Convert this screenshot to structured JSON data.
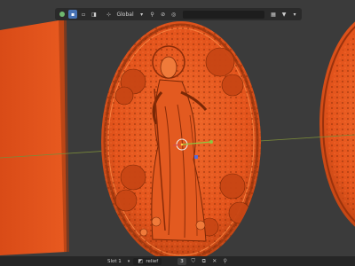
{
  "header": {
    "orientation_label": "Global",
    "icons": [
      "dot-green-icon",
      "select-box-icon",
      "select-icon",
      "search-icon",
      "pivot-icon",
      "snap-icon",
      "proportional-edit-icon",
      "filter-icon"
    ]
  },
  "footer": {
    "slot_label": "Slot 1",
    "image_name": "relief",
    "user_count": "3"
  },
  "colors": {
    "relief_orange": "#e8541f",
    "relief_dark": "#8a2c08",
    "background": "#3b3b3b",
    "axis_line": "#7a8a3a",
    "gizmo_x": "#d94a4a",
    "gizmo_y": "#8cc63f",
    "gizmo_z": "#5a6cd6"
  }
}
